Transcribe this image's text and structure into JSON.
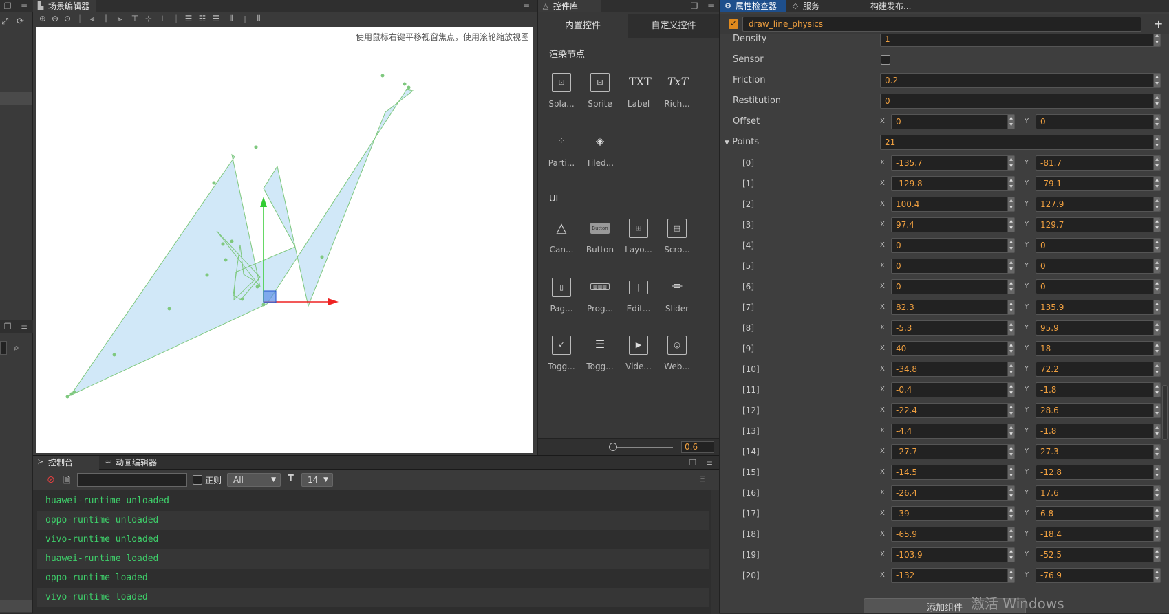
{
  "scene": {
    "tab_title": "场景编辑器",
    "hint": "使用鼠标右键平移视窗焦点，使用滚轮缩放视图"
  },
  "library": {
    "tab_title": "控件库",
    "tabs": [
      "内置控件",
      "自定义控件"
    ],
    "render_section": "渲染节点",
    "render_items": [
      "Spla...",
      "Sprite",
      "Label",
      "Rich...",
      "Parti...",
      "Tiled..."
    ],
    "ui_section": "UI",
    "ui_items": [
      "Can...",
      "Button",
      "Layo...",
      "Scro...",
      "Pag...",
      "Prog...",
      "Edit...",
      "Slider",
      "Togg...",
      "Togg...",
      "Vide...",
      "Web..."
    ],
    "button_icon_text": "Button",
    "txt_icon": "TXT",
    "rich_icon": "TxT",
    "zoom_value": "0.6"
  },
  "console": {
    "tab_title": "控制台",
    "anim_tab_title": "动画编辑器",
    "regex_label": "正则",
    "filter_value": "All",
    "font_size_value": "14",
    "logs": [
      "huawei-runtime unloaded",
      "oppo-runtime unloaded",
      "vivo-runtime unloaded",
      "huawei-runtime loaded",
      "oppo-runtime loaded",
      "vivo-runtime loaded"
    ]
  },
  "inspector": {
    "tabs": [
      "属性检查器",
      "服务",
      "构建发布..."
    ],
    "component_name": "draw_line_physics",
    "density_label": "Density",
    "density_value": "1",
    "sensor_label": "Sensor",
    "friction_label": "Friction",
    "friction_value": "0.2",
    "restitution_label": "Restitution",
    "restitution_value": "0",
    "offset_label": "Offset",
    "offset_x": "0",
    "offset_y": "0",
    "points_label": "Points",
    "points_count": "21",
    "x_tag": "X",
    "y_tag": "Y",
    "points": [
      {
        "i": "[0]",
        "x": "-135.7",
        "y": "-81.7"
      },
      {
        "i": "[1]",
        "x": "-129.8",
        "y": "-79.1"
      },
      {
        "i": "[2]",
        "x": "100.4",
        "y": "127.9"
      },
      {
        "i": "[3]",
        "x": "97.4",
        "y": "129.7"
      },
      {
        "i": "[4]",
        "x": "0",
        "y": "0"
      },
      {
        "i": "[5]",
        "x": "0",
        "y": "0"
      },
      {
        "i": "[6]",
        "x": "0",
        "y": "0"
      },
      {
        "i": "[7]",
        "x": "82.3",
        "y": "135.9"
      },
      {
        "i": "[8]",
        "x": "-5.3",
        "y": "95.9"
      },
      {
        "i": "[9]",
        "x": "40",
        "y": "18"
      },
      {
        "i": "[10]",
        "x": "-34.8",
        "y": "72.2"
      },
      {
        "i": "[11]",
        "x": "-0.4",
        "y": "-1.8"
      },
      {
        "i": "[12]",
        "x": "-22.4",
        "y": "28.6"
      },
      {
        "i": "[13]",
        "x": "-4.4",
        "y": "-1.8"
      },
      {
        "i": "[14]",
        "x": "-27.7",
        "y": "27.3"
      },
      {
        "i": "[15]",
        "x": "-14.5",
        "y": "-12.8"
      },
      {
        "i": "[16]",
        "x": "-26.4",
        "y": "17.6"
      },
      {
        "i": "[17]",
        "x": "-39",
        "y": "6.8"
      },
      {
        "i": "[18]",
        "x": "-65.9",
        "y": "-18.4"
      },
      {
        "i": "[19]",
        "x": "-103.9",
        "y": "-52.5"
      },
      {
        "i": "[20]",
        "x": "-132",
        "y": "-76.9"
      }
    ],
    "add_component": "添加组件",
    "watermark": "激活 Windows"
  },
  "colors": {
    "shape_fill": "#cce5f7",
    "shape_stroke": "#7ec87e",
    "log_text": "#3ecf6a",
    "field_text": "#f0a040",
    "active_tab": "#1e4f8c"
  }
}
